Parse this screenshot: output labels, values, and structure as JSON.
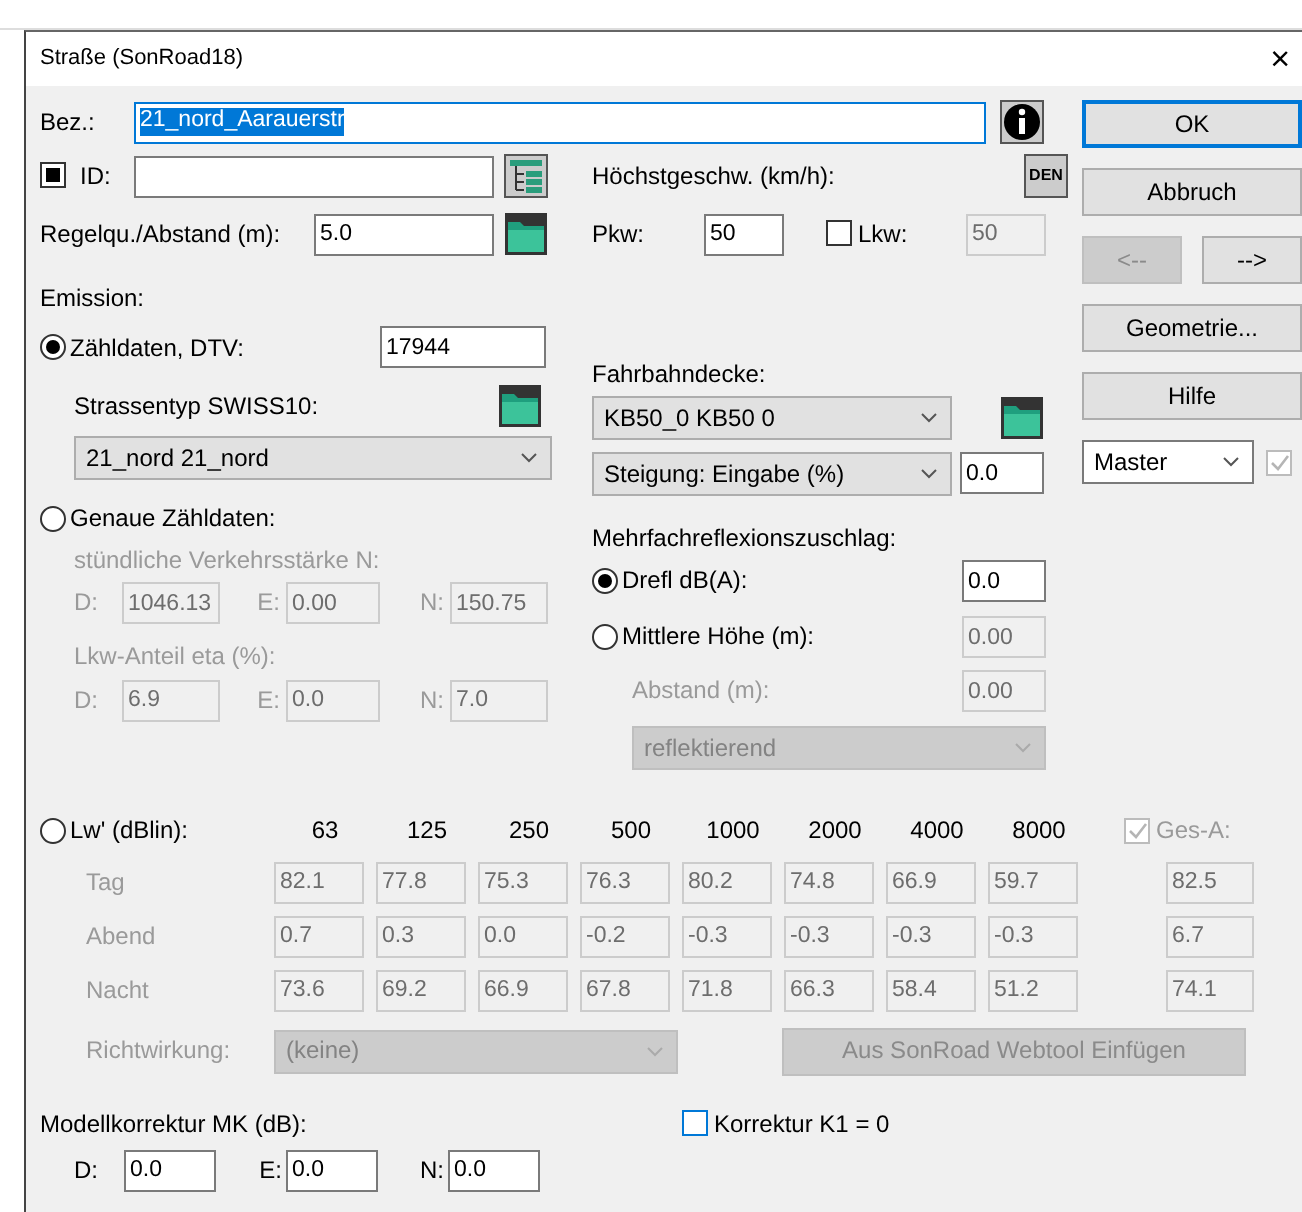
{
  "window": {
    "title": "Straße (SonRoad18)",
    "close": "×"
  },
  "name": {
    "label": "Bez.:",
    "value": "21_nord_Aarauerstr",
    "text_selected": true
  },
  "id": {
    "label": "ID:",
    "checked": true
  },
  "speed_label": "Höchstgeschw. (km/h):",
  "den_button": "DEN",
  "spacing": {
    "label": "Regelqu./Abstand (m):",
    "value": "5.0"
  },
  "pkw": {
    "label": "Pkw:",
    "value": "50"
  },
  "lkw": {
    "label": "Lkw:",
    "checked": false,
    "value": "50",
    "disabled": true
  },
  "emission_label": "Emission:",
  "counts": {
    "label": "Zähldaten, DTV:",
    "selected": true,
    "value": "17944",
    "road_type_label": "Strassentyp SWISS10:",
    "road_type": "21_nord 21_nord"
  },
  "exact": {
    "label": "Genaue Zähldaten:",
    "selected": false,
    "disabled": true,
    "hourly_label": "stündliche Verkehrsstärke N:",
    "hourly": [
      {
        "label": "D:",
        "value": "1046.13"
      },
      {
        "label": "E:",
        "value": "0.00"
      },
      {
        "label": "N:",
        "value": "150.75"
      }
    ],
    "truck_label": "Lkw-Anteil eta (%):",
    "truck": [
      {
        "label": "D:",
        "value": "6.9"
      },
      {
        "label": "E:",
        "value": "0.0"
      },
      {
        "label": "N:",
        "value": "7.0"
      }
    ]
  },
  "surface": {
    "label": "Fahrbahndecke:",
    "value": "KB50_0 KB50 0"
  },
  "gradient": {
    "mode": "Steigung: Eingabe (%)",
    "value": "0.0"
  },
  "reflection": {
    "label": "Mehrfachreflexionszuschlag:",
    "options": [
      {
        "label": "Drefl dB(A):",
        "selected": true,
        "value": "0.0"
      },
      {
        "label": "Mittlere Höhe (m):",
        "selected": false,
        "value": "0.00"
      }
    ],
    "distance_label": "Abstand (m):",
    "distance": "0.00",
    "type": "reflektierend",
    "disabled": true
  },
  "lw": {
    "label": "Lw' (dBlin):",
    "selected": false,
    "disabled": true,
    "bands": [
      "63",
      "125",
      "250",
      "500",
      "1000",
      "2000",
      "4000",
      "8000"
    ],
    "total_label": "Ges-A:",
    "total_checked": true,
    "rows": [
      {
        "label": "Tag",
        "values": [
          "82.1",
          "77.8",
          "75.3",
          "76.3",
          "80.2",
          "74.8",
          "66.9",
          "59.7"
        ],
        "total": "82.5"
      },
      {
        "label": "Abend",
        "values": [
          "0.7",
          "0.3",
          "0.0",
          "-0.2",
          "-0.3",
          "-0.3",
          "-0.3",
          "-0.3"
        ],
        "total": "6.7"
      },
      {
        "label": "Nacht",
        "values": [
          "73.6",
          "69.2",
          "66.9",
          "67.8",
          "71.8",
          "66.3",
          "58.4",
          "51.2"
        ],
        "total": "74.1"
      }
    ]
  },
  "directivity": {
    "label": "Richtwirkung:",
    "value": "(keine)",
    "disabled": true
  },
  "import_button": {
    "label": "Aus SonRoad Webtool Einfügen",
    "disabled": true
  },
  "model_correction": {
    "label": "Modellkorrektur MK (dB):",
    "fields": [
      {
        "label": "D:",
        "value": "0.0"
      },
      {
        "label": "E:",
        "value": "0.0"
      },
      {
        "label": "N:",
        "value": "0.0"
      }
    ]
  },
  "k1": {
    "label": "Korrektur K1 = 0",
    "checked": false
  },
  "buttons": [
    {
      "label": "OK",
      "kind": "full",
      "default": true,
      "disabled": false
    },
    {
      "label": "Abbruch",
      "kind": "full",
      "default": false,
      "disabled": false
    },
    {
      "label": "<--",
      "kind": "half",
      "default": false,
      "disabled": true
    },
    {
      "label": "-->",
      "kind": "half",
      "default": false,
      "disabled": false
    },
    {
      "label": "Geometrie...",
      "kind": "full",
      "default": false,
      "disabled": false
    },
    {
      "label": "Hilfe",
      "kind": "full",
      "default": false,
      "disabled": false
    }
  ],
  "variant": {
    "value": "Master",
    "checked": true,
    "disabled": true
  }
}
